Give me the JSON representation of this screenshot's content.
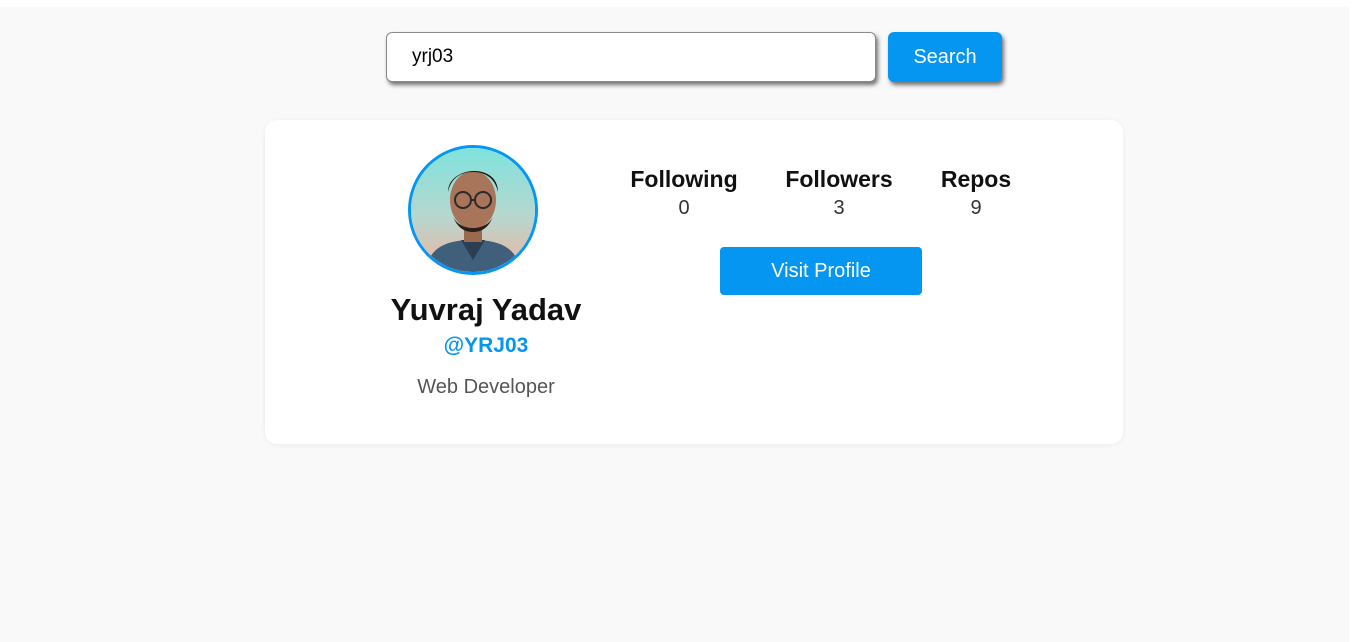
{
  "search": {
    "value": "yrj03",
    "button_label": "Search"
  },
  "profile": {
    "name": "Yuvraj Yadav",
    "handle": "@YRJ03",
    "bio": "Web Developer",
    "avatar_icon": "user-avatar-photo"
  },
  "stats": [
    {
      "label": "Following",
      "value": "0"
    },
    {
      "label": "Followers",
      "value": "3"
    },
    {
      "label": "Repos",
      "value": "9"
    }
  ],
  "visit_button_label": "Visit Profile",
  "colors": {
    "accent": "#0596f2",
    "page_background": "#f9f9f9",
    "card_background": "#ffffff"
  }
}
